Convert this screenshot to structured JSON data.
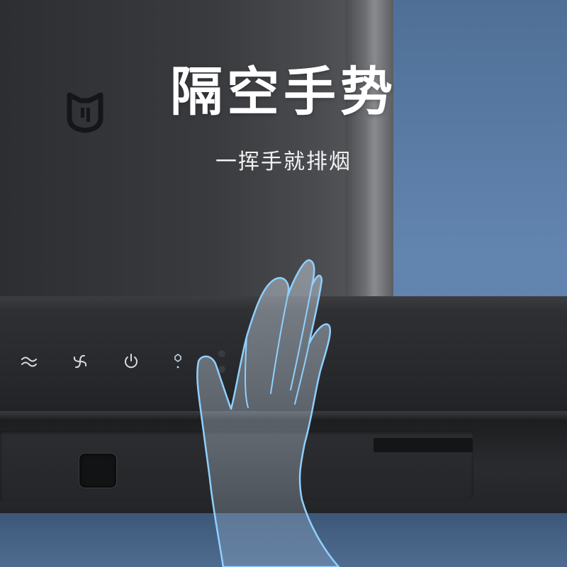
{
  "headline": "隔空手势",
  "subline": "一挥手就排烟",
  "logo_icon": "mi-home-logo-icon",
  "controls": [
    {
      "icon": "wave-mode-icon"
    },
    {
      "icon": "fan-icon"
    },
    {
      "icon": "power-icon"
    },
    {
      "icon": "light-icon"
    }
  ],
  "colors": {
    "hood": "#2f3034",
    "wall": "#5e7fa6",
    "text": "#ffffff",
    "hand_outline": "#8fd0ff"
  }
}
